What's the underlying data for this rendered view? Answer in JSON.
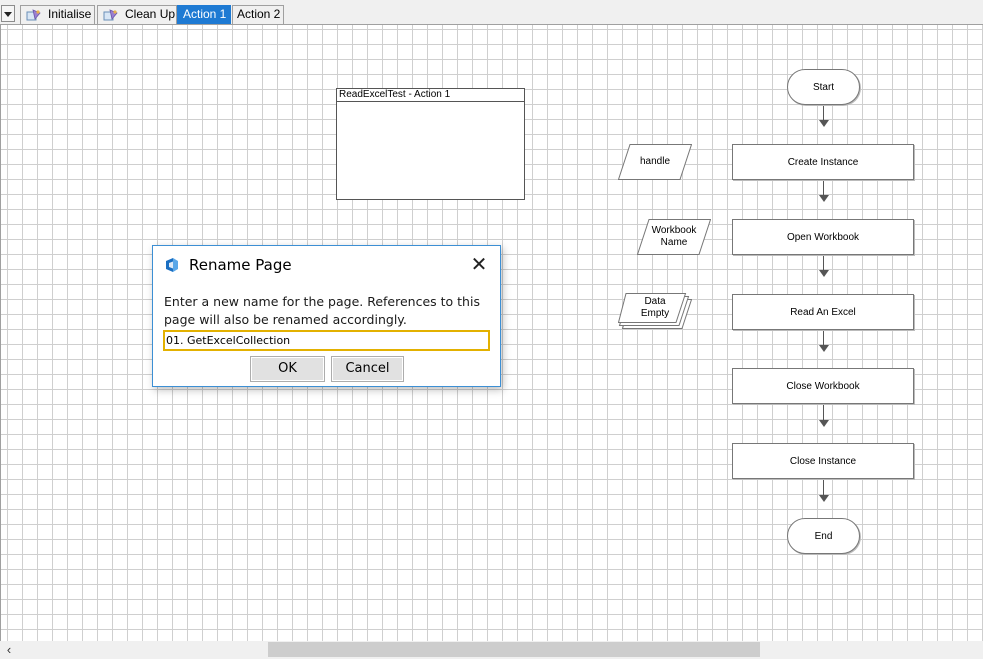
{
  "tabs": [
    {
      "label": "Initialise",
      "active": false,
      "icon": "page-icon"
    },
    {
      "label": "Clean Up",
      "active": false,
      "icon": "page-icon"
    },
    {
      "label": "Action 1",
      "active": true,
      "icon": null
    },
    {
      "label": "Action 2",
      "active": false,
      "icon": null
    }
  ],
  "canvas": {
    "info_box": {
      "title": "ReadExcelTest - Action 1"
    },
    "flow": {
      "start": "Start",
      "steps": [
        "Create Instance",
        "Open Workbook",
        "Read An Excel",
        "Close Workbook",
        "Close Instance"
      ],
      "end": "End"
    },
    "data_items": {
      "handle": "handle",
      "workbook_name": "Workbook Name",
      "collection": "Data Empty"
    }
  },
  "dialog": {
    "title": "Rename Page",
    "message": "Enter a new name for the page. References to this page will also be renamed accordingly.",
    "input_value": "01. GetExcelCollection",
    "ok_label": "OK",
    "cancel_label": "Cancel",
    "icon": "app-logo-icon"
  },
  "colors": {
    "active_tab": "#1e7ad3",
    "input_focus_border": "#e3b100",
    "dialog_border": "#3c8fd4",
    "grid": "#cfcfcf"
  }
}
